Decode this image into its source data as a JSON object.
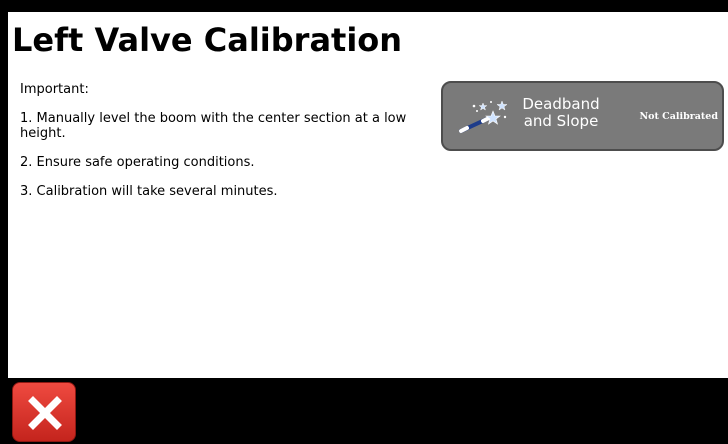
{
  "page": {
    "title": "Left Valve Calibration"
  },
  "instructions": {
    "heading": "Important:",
    "steps": [
      "1. Manually level the boom with the center section at a low height.",
      "2. Ensure safe operating conditions.",
      "3. Calibration will take several minutes."
    ]
  },
  "calibration_button": {
    "label": "Deadband and Slope",
    "status": "Not Calibrated",
    "icon": "magic-wand-icon"
  },
  "footer": {
    "close_icon": "close-icon"
  },
  "colors": {
    "background": "#000000",
    "panel": "#ffffff",
    "button_gray": "#7a7a7a",
    "close_red": "#d9332b"
  }
}
